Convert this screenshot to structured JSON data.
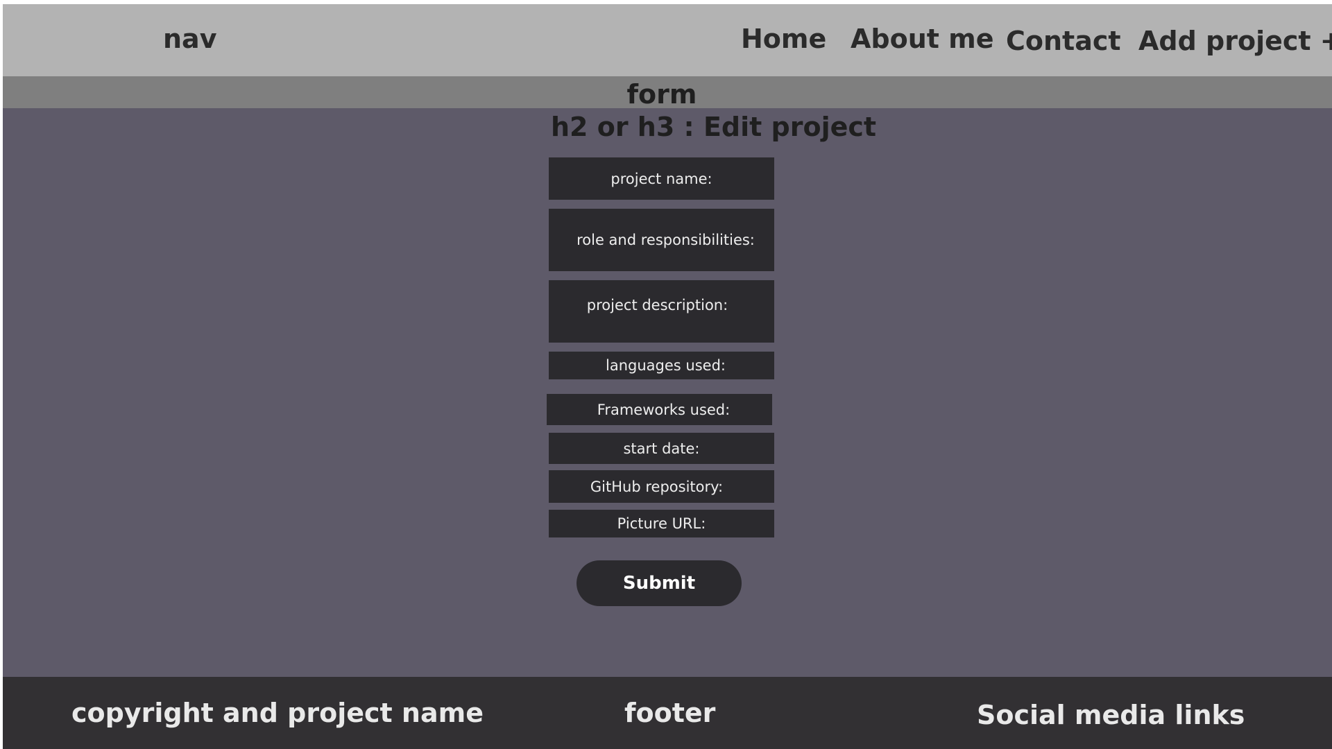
{
  "nav": {
    "label": "nav",
    "links": [
      "Home",
      "About me",
      "Contact",
      "Add project +"
    ]
  },
  "form_section": {
    "label": "form",
    "title": "h2 or h3 : Edit project",
    "fields": [
      "project name:",
      "role and responsibilities:",
      "project description:",
      "languages used:",
      "Frameworks used:",
      "start date:",
      "GitHub repository:",
      "Picture URL:"
    ],
    "submit_label": "Submit"
  },
  "footer": {
    "left": "copyright and project name",
    "center": "footer",
    "right": "Social media links"
  },
  "colors": {
    "nav_bg": "#b3b3b3",
    "form_band_bg": "#7f7f7f",
    "page_bg": "#5e5a69",
    "field_bg": "#2b2a2e",
    "footer_bg": "#323033"
  }
}
